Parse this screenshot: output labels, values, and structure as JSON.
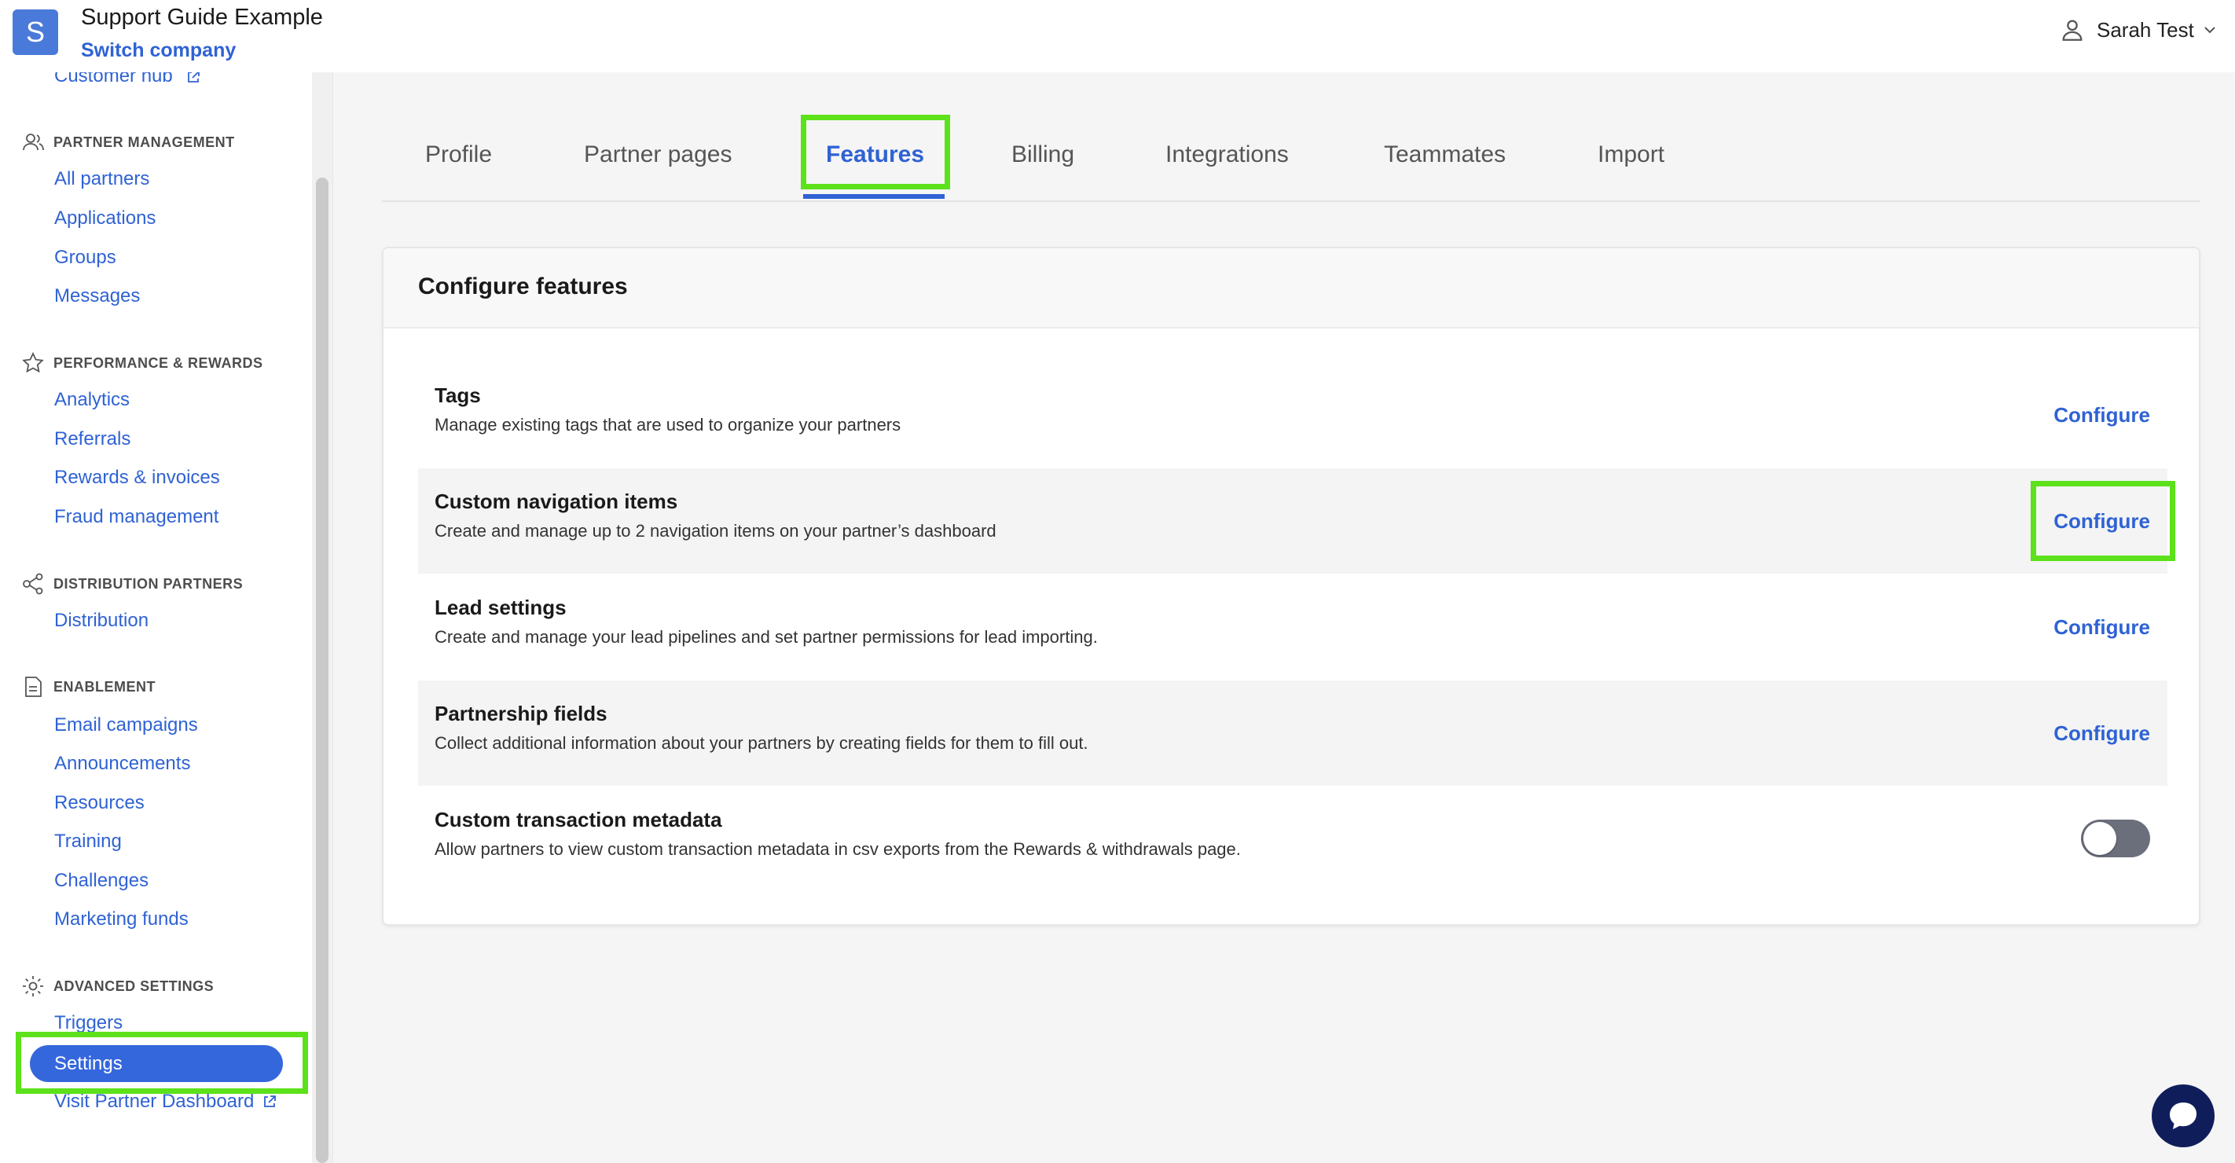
{
  "header": {
    "logo_letter": "S",
    "company_name": "Support Guide Example",
    "switch_company": "Switch company",
    "user_name": "Sarah Test"
  },
  "sidebar": {
    "customer_hub": "Customer hub",
    "sections": {
      "partner_management": {
        "title": "PARTNER MANAGEMENT",
        "items": [
          "All partners",
          "Applications",
          "Groups",
          "Messages"
        ]
      },
      "performance_rewards": {
        "title": "PERFORMANCE & REWARDS",
        "items": [
          "Analytics",
          "Referrals",
          "Rewards & invoices",
          "Fraud management"
        ]
      },
      "distribution_partners": {
        "title": "DISTRIBUTION PARTNERS",
        "items": [
          "Distribution"
        ]
      },
      "enablement": {
        "title": "ENABLEMENT",
        "items": [
          "Email campaigns",
          "Announcements",
          "Resources",
          "Training",
          "Challenges",
          "Marketing funds"
        ]
      },
      "advanced_settings": {
        "title": "ADVANCED SETTINGS",
        "items": [
          "Triggers",
          "Settings",
          "Visit Partner Dashboard"
        ]
      }
    },
    "active_item": "Settings"
  },
  "tabs": {
    "items": [
      "Profile",
      "Partner pages",
      "Features",
      "Billing",
      "Integrations",
      "Teammates",
      "Import"
    ],
    "active": "Features"
  },
  "card": {
    "title": "Configure features",
    "configure_label": "Configure",
    "features": [
      {
        "title": "Tags",
        "description": "Manage existing tags that are used to organize your partners",
        "control": "configure"
      },
      {
        "title": "Custom navigation items",
        "description": "Create and manage up to 2 navigation items on your partner’s dashboard",
        "control": "configure"
      },
      {
        "title": "Lead settings",
        "description": "Create and manage your lead pipelines and set partner permissions for lead importing.",
        "control": "configure"
      },
      {
        "title": "Partnership fields",
        "description": "Collect additional information about your partners by creating fields for them to fill out.",
        "control": "configure"
      },
      {
        "title": "Custom transaction metadata",
        "description": "Allow partners to view custom transaction metadata in csv exports from the Rewards & withdrawals page.",
        "control": "toggle",
        "enabled": false
      }
    ]
  },
  "colors": {
    "accent": "#2f62d4",
    "highlight": "#5ce11a",
    "chat": "#0f1e5b"
  },
  "icons": [
    "user-icon",
    "chevron-down-icon",
    "external-link-icon",
    "partners-icon",
    "star-icon",
    "share-icon",
    "document-icon",
    "gear-icon",
    "chat-icon"
  ]
}
